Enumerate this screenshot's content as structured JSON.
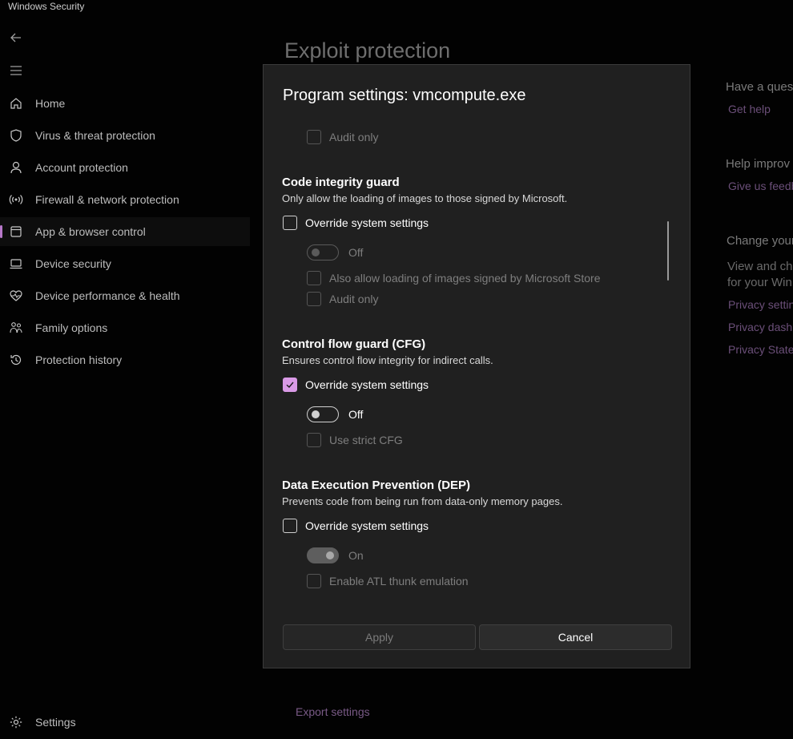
{
  "app": {
    "title": "Windows Security"
  },
  "nav": {
    "back_icon": "back-arrow-icon",
    "menu_icon": "hamburger-menu-icon",
    "items": [
      {
        "label": "Home",
        "icon": "home-icon"
      },
      {
        "label": "Virus & threat protection",
        "icon": "shield-icon"
      },
      {
        "label": "Account protection",
        "icon": "person-icon"
      },
      {
        "label": "Firewall & network protection",
        "icon": "wifi-signal-icon"
      },
      {
        "label": "App & browser control",
        "icon": "app-window-icon",
        "active": true
      },
      {
        "label": "Device security",
        "icon": "laptop-icon"
      },
      {
        "label": "Device performance & health",
        "icon": "heart-pulse-icon"
      },
      {
        "label": "Family options",
        "icon": "family-icon"
      },
      {
        "label": "Protection history",
        "icon": "history-icon"
      }
    ],
    "settings": {
      "label": "Settings",
      "icon": "gear-icon"
    }
  },
  "page": {
    "title": "Exploit protection",
    "export_label": "Export settings"
  },
  "right_panel": {
    "question_heading": "Have a quest",
    "get_help": "Get help",
    "improve_heading": "Help improv",
    "feedback": "Give us feedb",
    "change_heading": "Change your",
    "change_text_1": "View and cha",
    "change_text_2": "for your Win",
    "links": [
      "Privacy settin",
      "Privacy dashb",
      "Privacy Stater"
    ]
  },
  "dialog": {
    "title": "Program settings: vmcompute.exe",
    "top_audit": "Audit only",
    "code_integrity": {
      "heading": "Code integrity guard",
      "description": "Only allow the loading of images to those signed by Microsoft.",
      "override": "Override system settings",
      "override_checked": false,
      "toggle": "Off",
      "toggle_on": false,
      "also_allow": "Also allow loading of images signed by Microsoft Store",
      "audit": "Audit only"
    },
    "cfg": {
      "heading": "Control flow guard (CFG)",
      "description": "Ensures control flow integrity for indirect calls.",
      "override": "Override system settings",
      "override_checked": true,
      "toggle": "Off",
      "toggle_on": false,
      "strict": "Use strict CFG"
    },
    "dep": {
      "heading": "Data Execution Prevention (DEP)",
      "description": "Prevents code from being run from data-only memory pages.",
      "override": "Override system settings",
      "override_checked": false,
      "toggle": "On",
      "toggle_on": true,
      "atl": "Enable ATL thunk emulation"
    },
    "apply_label": "Apply",
    "cancel_label": "Cancel"
  },
  "colors": {
    "accent": "#d99ae6",
    "active_indicator": "#b778c9",
    "dialog_bg": "#202020",
    "page_bg": "#020202"
  }
}
